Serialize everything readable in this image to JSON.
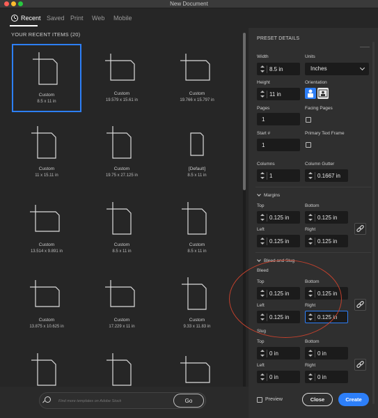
{
  "window": {
    "title": "New Document"
  },
  "tabs": [
    {
      "label": "Recent",
      "active": true
    },
    {
      "label": "Saved"
    },
    {
      "label": "Print"
    },
    {
      "label": "Web"
    },
    {
      "label": "Mobile"
    }
  ],
  "recent": {
    "header": "YOUR RECENT ITEMS",
    "count": "(20)",
    "items": [
      {
        "name": "Custom",
        "size": "8.5 x 11 in",
        "orientation": "portrait",
        "selected": true
      },
      {
        "name": "Custom",
        "size": "19.579 x 15.61 in",
        "orientation": "landscape"
      },
      {
        "name": "Custom",
        "size": "19.766 x 15.797 in",
        "orientation": "landscape"
      },
      {
        "name": "Custom",
        "size": "11 x 15.11 in",
        "orientation": "portrait"
      },
      {
        "name": "Custom",
        "size": "19.75 x 27.125 in",
        "orientation": "portrait"
      },
      {
        "name": "[Default]",
        "size": "8.5 x 11 in",
        "orientation": "portrait-plain"
      },
      {
        "name": "Custom",
        "size": "13.514 x 9.891 in",
        "orientation": "landscape"
      },
      {
        "name": "Custom",
        "size": "8.5 x 11 in",
        "orientation": "portrait"
      },
      {
        "name": "Custom",
        "size": "8.5 x 11 in",
        "orientation": "portrait"
      },
      {
        "name": "Custom",
        "size": "13.875 x 10.625 in",
        "orientation": "landscape"
      },
      {
        "name": "Custom",
        "size": "17.229 x 11 in",
        "orientation": "landscape"
      },
      {
        "name": "Custom",
        "size": "9.33 x 11.83 in",
        "orientation": "portrait"
      },
      {
        "name": "",
        "size": "",
        "orientation": "portrait"
      },
      {
        "name": "",
        "size": "",
        "orientation": "portrait"
      },
      {
        "name": "",
        "size": "",
        "orientation": "landscape"
      }
    ]
  },
  "search": {
    "placeholder": "Find more templates on Adobe Stock",
    "go_label": "Go"
  },
  "preset": {
    "header": "PRESET DETAILS",
    "width_label": "Width",
    "width_value": "8.5 in",
    "units_label": "Units",
    "units_value": "Inches",
    "height_label": "Height",
    "height_value": "11 in",
    "orientation_label": "Orientation",
    "pages_label": "Pages",
    "pages_value": "1",
    "facing_label": "Facing Pages",
    "start_label": "Start #",
    "start_value": "1",
    "primary_label": "Primary Text Frame",
    "columns_label": "Columns",
    "columns_value": "1",
    "gutter_label": "Column Gutter",
    "gutter_value": "0.1667 in",
    "margins": {
      "title": "Margins",
      "top_label": "Top",
      "top_value": "0.125 in",
      "bottom_label": "Bottom",
      "bottom_value": "0.125 in",
      "left_label": "Left",
      "left_value": "0.125 in",
      "right_label": "Right",
      "right_value": "0.125 in"
    },
    "bleed_slug_title": "Bleed and Slug",
    "bleed": {
      "title": "Bleed",
      "top_label": "Top",
      "top_value": "0.125 in",
      "bottom_label": "Bottom",
      "bottom_value": "0.125 in",
      "left_label": "Left",
      "left_value": "0.125 in",
      "right_label": "Right",
      "right_value": "0.125 in"
    },
    "slug": {
      "title": "Slug",
      "top_label": "Top",
      "top_value": "0 in",
      "bottom_label": "Bottom",
      "bottom_value": "0 in",
      "left_label": "Left",
      "left_value": "0 in",
      "right_label": "Right",
      "right_value": "0 in"
    },
    "preview_label": "Preview",
    "close_label": "Close",
    "create_label": "Create"
  },
  "colors": {
    "accent": "#2d7ff9",
    "annotation": "#c2412d"
  }
}
